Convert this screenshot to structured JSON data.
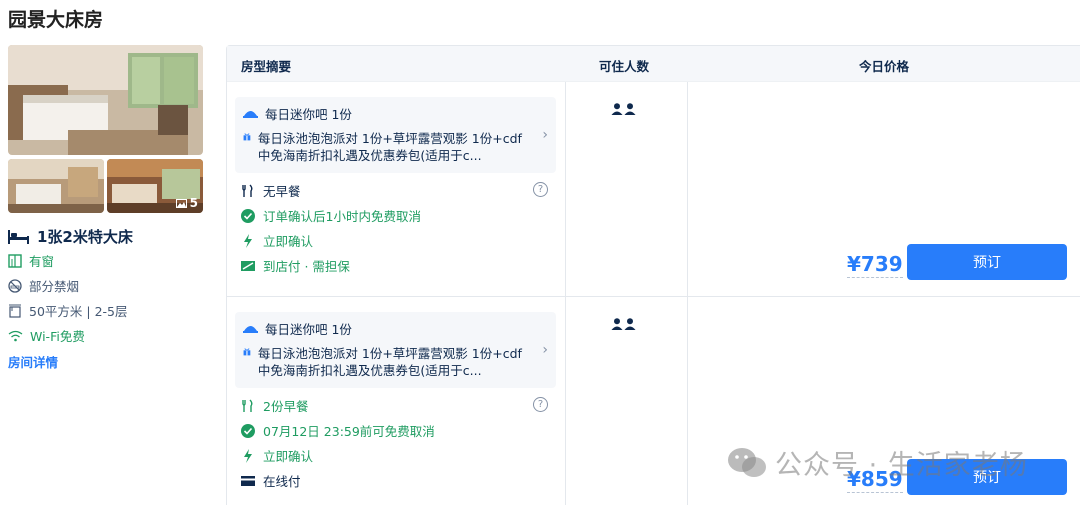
{
  "room": {
    "title": "园景大床房",
    "photo_count": "5",
    "bed": "1张2米特大床",
    "facilities": [
      {
        "icon": "window-icon",
        "label": "有窗"
      },
      {
        "icon": "no-smoking-icon",
        "label": "部分禁烟"
      },
      {
        "icon": "area-icon",
        "label": "50平方米 | 2-5层"
      },
      {
        "icon": "wifi-icon",
        "label": "Wi-Fi免费"
      }
    ],
    "detail_link": "房间详情"
  },
  "table": {
    "headers": {
      "summary": "房型摘要",
      "guests": "可住人数",
      "price": "今日价格"
    }
  },
  "offers": [
    {
      "package": [
        {
          "icon": "minibar-icon",
          "text": "每日迷你吧 1份"
        },
        {
          "icon": "gift-icon",
          "text": "每日泳池泡泡派对 1份+草坪露营观影 1份+cdf中免海南折扣礼遇及优惠券包(适用于c..."
        }
      ],
      "meal": "无早餐",
      "cancel": "订单确认后1小时内免费取消",
      "confirm": "立即确认",
      "payment": "到店付 · 需担保",
      "price": "¥739",
      "button": "预订"
    },
    {
      "package": [
        {
          "icon": "minibar-icon",
          "text": "每日迷你吧 1份"
        },
        {
          "icon": "gift-icon",
          "text": "每日泳池泡泡派对 1份+草坪露营观影 1份+cdf中免海南折扣礼遇及优惠券包(适用于c..."
        }
      ],
      "meal": "2份早餐",
      "cancel": "07月12日 23:59前可免费取消",
      "confirm": "立即确认",
      "payment": "在线付",
      "price": "¥859",
      "button": "预订"
    }
  ],
  "watermark": "公众号 · 生活家老杨",
  "colors": {
    "accent": "#287dfa",
    "green": "#1f9c61",
    "text": "#0f294d"
  }
}
